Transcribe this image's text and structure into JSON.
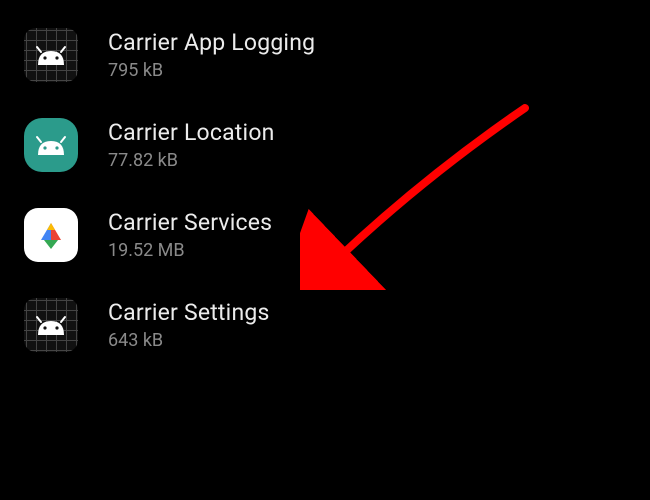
{
  "apps": [
    {
      "name": "Carrier App Logging",
      "size": "795 kB",
      "icon": "android-grid"
    },
    {
      "name": "Carrier Location",
      "size": "77.82 kB",
      "icon": "android-green"
    },
    {
      "name": "Carrier Services",
      "size": "19.52 MB",
      "icon": "play-services"
    },
    {
      "name": "Carrier Settings",
      "size": "643 kB",
      "icon": "android-grid"
    }
  ],
  "annotation": {
    "points_to_index": 2,
    "color": "#ff0000"
  }
}
